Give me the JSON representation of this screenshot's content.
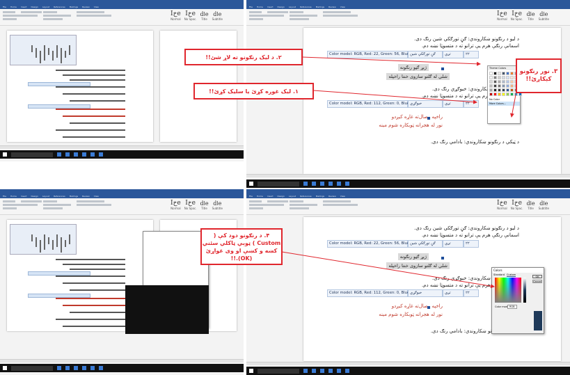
{
  "app": {
    "ribbon_tabs": [
      "File",
      "Home",
      "Insert",
      "Design",
      "Layout",
      "References",
      "Mailings",
      "Review",
      "View"
    ]
  },
  "styles": {
    "samples": [
      "Iخe",
      "Iخe",
      "dاe",
      "dاe"
    ],
    "labels": [
      "Normal",
      "No Spac.",
      "Title",
      "Subtitle"
    ]
  },
  "doc": {
    "line1": "د ليو د رنګونو ښکاروندي: ګڼ تورګکي شين رنګ دی.",
    "line2": "اسمانې رنګې هرم يې ترانو ته د متسوټا نښه دم.",
    "row1": {
      "model": "Color model: RGB, Red: 22, Green: 56, Blue:86",
      "col2": "ګڼ تورګکي شين",
      "col3": "تږي",
      "col4": "۲۲"
    },
    "shade1": "ژيړ ګڼو رنګونه",
    "shade2": "شلي له ګلتو سازوی خنتا راخپله",
    "line3": "د نيو د رنګونو ښکاروندي: خيوګړي رنګ دی.",
    "line4": "اسمانې رنګې هرم يې ترانو ته د متسوټا نښه دم.",
    "row2": {
      "model": "Color model: RGB, Red: 112, Green: 0, Blue:0",
      "col2": "خيوګړي",
      "col3": "تږي",
      "col4": "۲۲"
    },
    "line5": "راخپه وصال‌ته غاړه کيږدو",
    "line6": "نور له هجرانه ټوبکاره شوم مينه",
    "line7": "د ټيکي د رنګونو ښکاروندي: بادامي رنګ دی."
  },
  "palette": {
    "title": "Theme Colors",
    "no_color": "No Color",
    "more": "More Colors..."
  },
  "dialog": {
    "title": "Colors",
    "tab_standard": "Standard",
    "tab_custom": "Custom",
    "ok": "OK",
    "cancel": "Cancel",
    "model_label": "Color model:",
    "model": "RGB"
  },
  "annotations": {
    "a1": "۲. د ليک رنګونو ته لاړ شئ!!",
    "a2": "۱. ليک غوره کړئ يا سليک کړئ!!",
    "a3": "۳. نور رنګونو کېکاږئ!!",
    "a4": "۴. د رنګونو دود کې ( Custom ) ټوبې ټاکلي سئني کښه و کښې او وی غواړئ (OK).!!"
  },
  "colors": {
    "ribbon": "#2b579a",
    "accent_red": "#e0262d",
    "custom_color": "#1f3a5a"
  }
}
